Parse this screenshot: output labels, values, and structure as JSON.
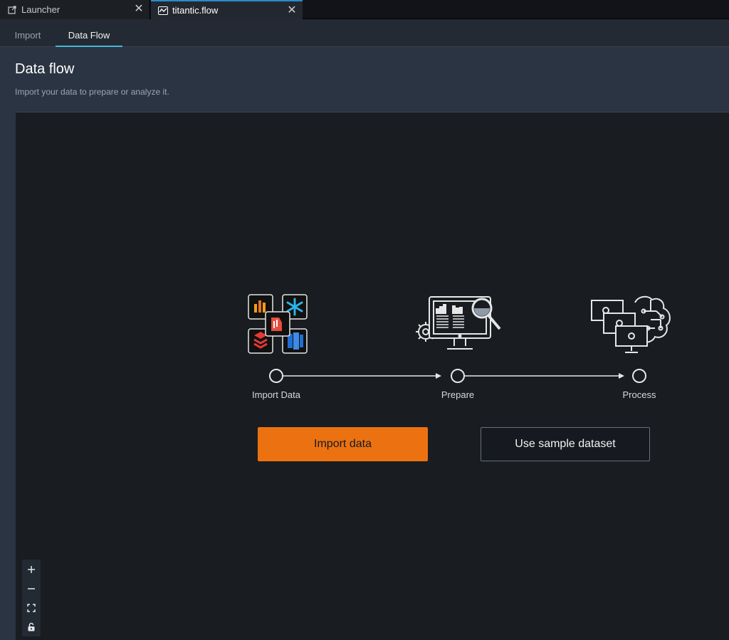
{
  "window_tabs": [
    {
      "label": "Launcher",
      "icon": "external-link-icon",
      "active": false
    },
    {
      "label": "titantic.flow",
      "icon": "flow-icon",
      "active": true
    }
  ],
  "sub_tabs": [
    {
      "label": "Import",
      "active": false
    },
    {
      "label": "Data Flow",
      "active": true
    }
  ],
  "header": {
    "title": "Data flow",
    "subtitle": "Import your data to prepare or analyze it."
  },
  "steps": [
    {
      "label": "Import Data",
      "icon": "data-sources-icon"
    },
    {
      "label": "Prepare",
      "icon": "monitor-magnifier-icon"
    },
    {
      "label": "Process",
      "icon": "brain-computers-icon"
    }
  ],
  "buttons": {
    "import": "Import data",
    "sample": "Use sample dataset"
  },
  "zoom_controls": [
    "zoom-in-icon",
    "zoom-out-icon",
    "fit-view-icon",
    "lock-icon"
  ],
  "colors": {
    "accent_orange": "#ec7211",
    "tab_accent": "#44b9d6",
    "canvas_bg": "#191c21",
    "header_bg": "#2b3442"
  }
}
